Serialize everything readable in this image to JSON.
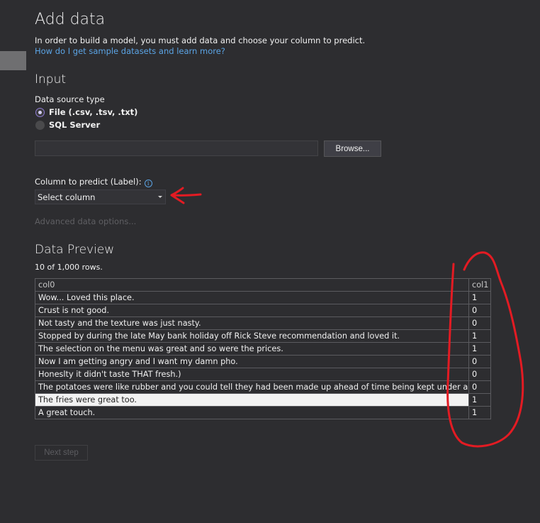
{
  "header": {
    "title": "Add data",
    "description": "In order to build a model, you must add data and choose your column to predict.",
    "help_link": "How do I get sample datasets and learn more?"
  },
  "input": {
    "section_title": "Input",
    "source_type_label": "Data source type",
    "options": [
      {
        "label": "File (.csv, .tsv, .txt)",
        "selected": true
      },
      {
        "label": "SQL Server",
        "selected": false
      }
    ],
    "path_value": "",
    "browse_label": "Browse...",
    "label_column_label": "Column to predict (Label):",
    "info_glyph": "i",
    "select_value": "Select column",
    "advanced_link": "Advanced data options..."
  },
  "preview": {
    "section_title": "Data Preview",
    "row_count": "10 of 1,000 rows.",
    "columns": [
      "col0",
      "col1"
    ],
    "rows": [
      [
        "Wow... Loved this place.",
        "1"
      ],
      [
        "Crust is not good.",
        "0"
      ],
      [
        "Not tasty and the texture was just nasty.",
        "0"
      ],
      [
        "Stopped by during the late May bank holiday off Rick Steve recommendation and loved it.",
        "1"
      ],
      [
        "The selection on the menu was great and so were the prices.",
        "1"
      ],
      [
        "Now I am getting angry and I want my damn pho.",
        "0"
      ],
      [
        "Honeslty it didn't taste THAT fresh.)",
        "0"
      ],
      [
        "The potatoes were like rubber and you could tell they had been made up ahead of time being kept under a warmer.",
        "0"
      ],
      [
        "The fries were great too.",
        "1"
      ],
      [
        "A great touch.",
        "1"
      ]
    ],
    "selected_row": 8
  },
  "footer": {
    "next_label": "Next step"
  },
  "colors": {
    "background": "#2d2d30",
    "link": "#5ba4e5",
    "annotation": "#e31b23",
    "radio_accent": "#8f7bd6"
  }
}
